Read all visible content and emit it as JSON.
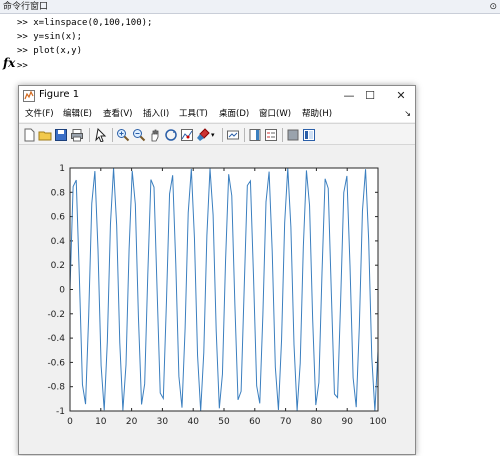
{
  "command_window": {
    "title": "命令行窗口",
    "menu_icon": "⊙",
    "lines": [
      ">> x=linspace(0,100,100);",
      ">> y=sin(x);",
      ">> plot(x,y)",
      ">>"
    ],
    "fx_label": "fx"
  },
  "figure": {
    "title": "Figure 1",
    "window_buttons": {
      "minimize": "—",
      "maximize": "☐",
      "close": "✕"
    },
    "menu": [
      "文件(F)",
      "编辑(E)",
      "查看(V)",
      "插入(I)",
      "工具(T)",
      "桌面(D)",
      "窗口(W)",
      "帮助(H)"
    ],
    "menu_expander": "↘",
    "toolbar_icons": [
      "new-figure-icon",
      "open-file-icon",
      "save-icon",
      "print-icon",
      "select-arrow-icon",
      "zoom-in-icon",
      "zoom-out-icon",
      "pan-icon",
      "rotate-3d-icon",
      "data-cursor-icon",
      "brush-icon",
      "link-plot-icon",
      "colorbar-icon",
      "legend-icon",
      "hide-plot-tools-icon",
      "show-plot-tools-icon"
    ]
  },
  "colors": {
    "line": "#3b7fbf",
    "axes": "#262626",
    "figure_bg": "#f0f0f0"
  },
  "chart_data": {
    "type": "line",
    "expression": "y = sin(x), x = linspace(0,100,100)",
    "x_start": 0,
    "x_end": 100,
    "n_points": 100,
    "xlim": [
      0,
      100
    ],
    "ylim": [
      -1,
      1
    ],
    "xticks": [
      0,
      10,
      20,
      30,
      40,
      50,
      60,
      70,
      80,
      90,
      100
    ],
    "yticks": [
      -1,
      -0.8,
      -0.6,
      -0.4,
      -0.2,
      0,
      0.2,
      0.4,
      0.6,
      0.8,
      1
    ],
    "xtick_labels": [
      "0",
      "10",
      "20",
      "30",
      "40",
      "50",
      "60",
      "70",
      "80",
      "90",
      "100"
    ],
    "ytick_labels": [
      "-1",
      "-0.8",
      "-0.6",
      "-0.4",
      "-0.2",
      "0",
      "0.2",
      "0.4",
      "0.6",
      "0.8",
      "1"
    ],
    "grid": false,
    "title": "",
    "xlabel": "",
    "ylabel": ""
  }
}
